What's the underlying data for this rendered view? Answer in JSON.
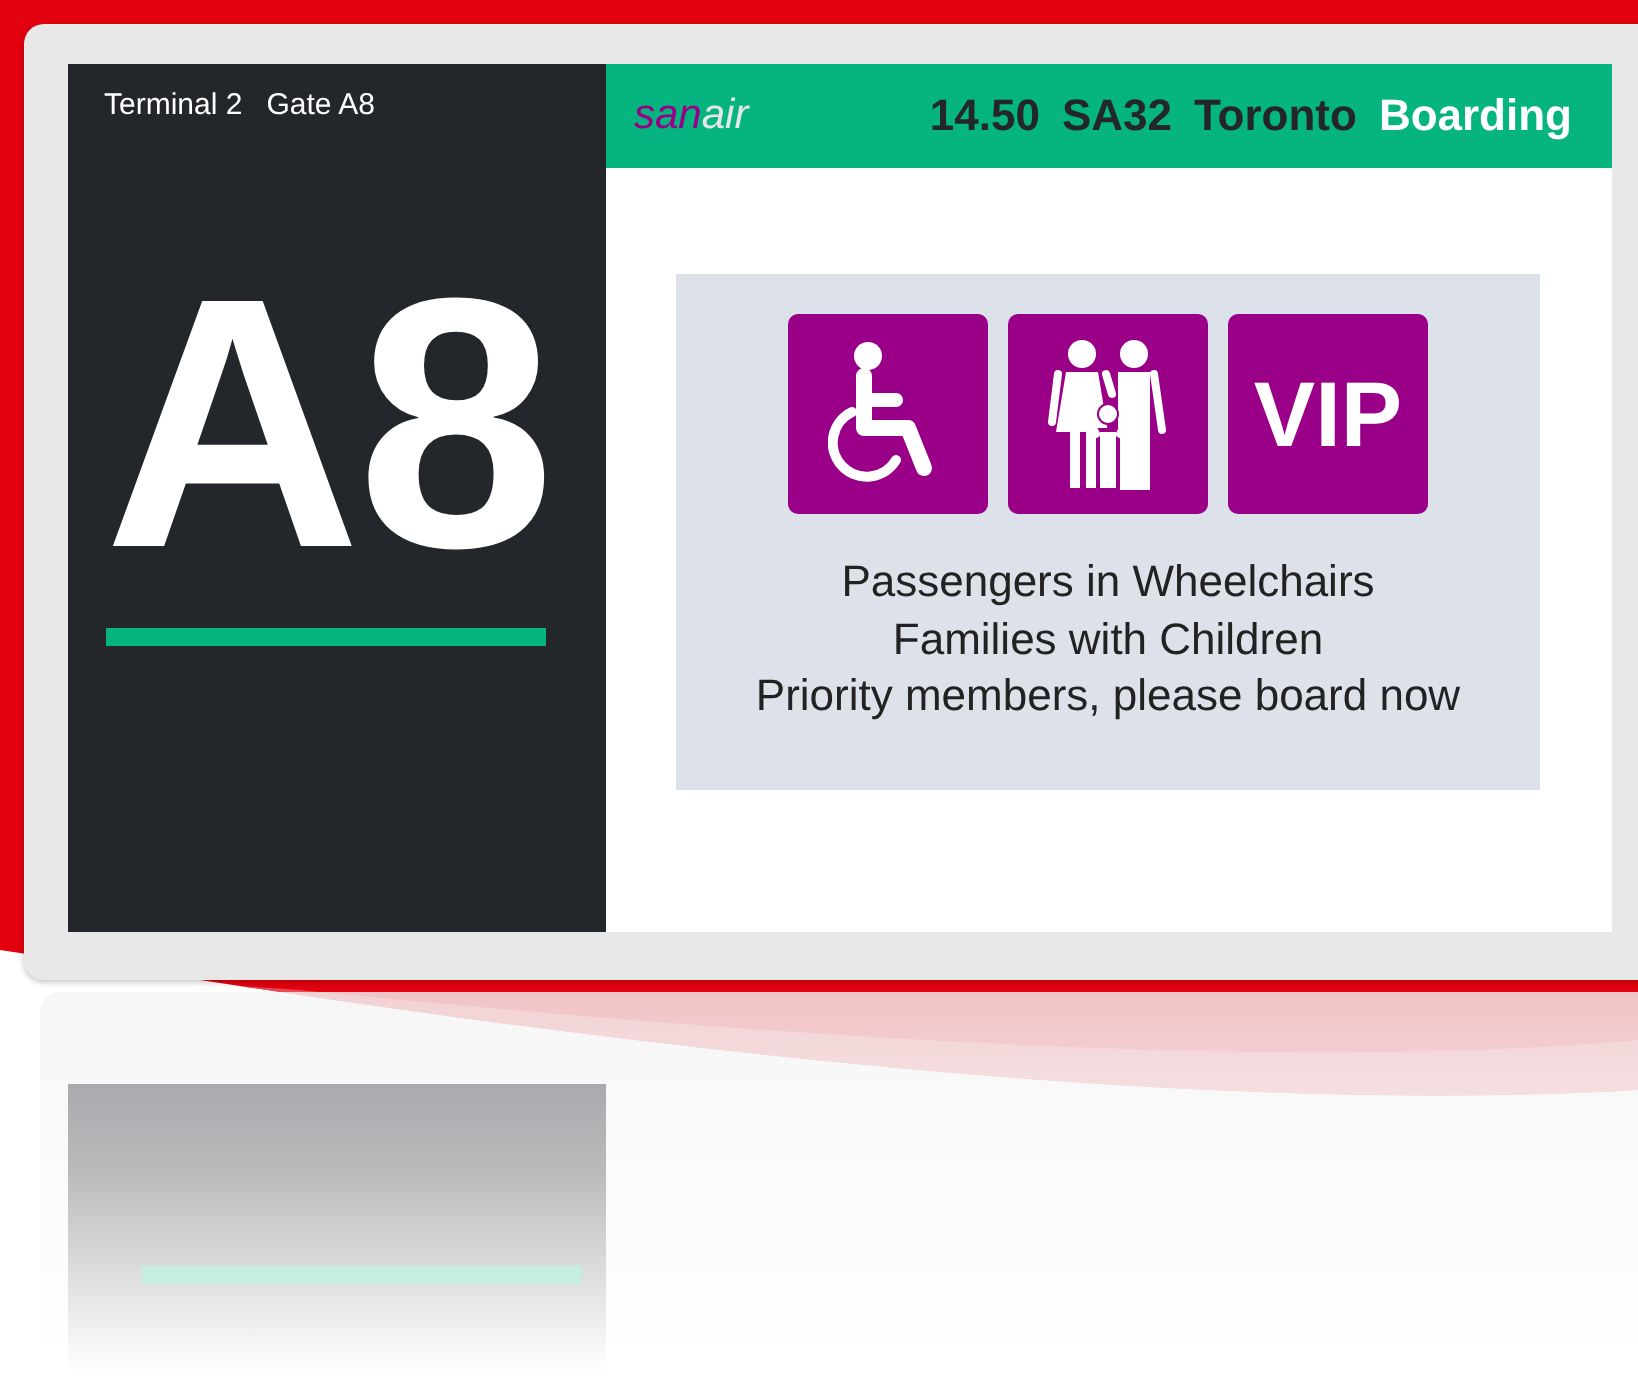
{
  "side": {
    "terminal": "Terminal 2",
    "gate_label": "Gate A8",
    "gate_code": "A8"
  },
  "header": {
    "logo": [
      {
        "text": "san",
        "color": "#990087"
      },
      {
        "text": "air",
        "color": "#e6e6e6"
      }
    ],
    "time": "14.50",
    "flight": "SA32",
    "destination": "Toronto",
    "status": "Boarding"
  },
  "notice": {
    "icons": [
      {
        "kind": "wheelchair"
      },
      {
        "kind": "family"
      },
      {
        "kind": "text",
        "text": "VIP"
      }
    ],
    "lines": [
      "Passengers in Wheelchairs",
      "Families with Children",
      "Priority members, please board now"
    ]
  }
}
